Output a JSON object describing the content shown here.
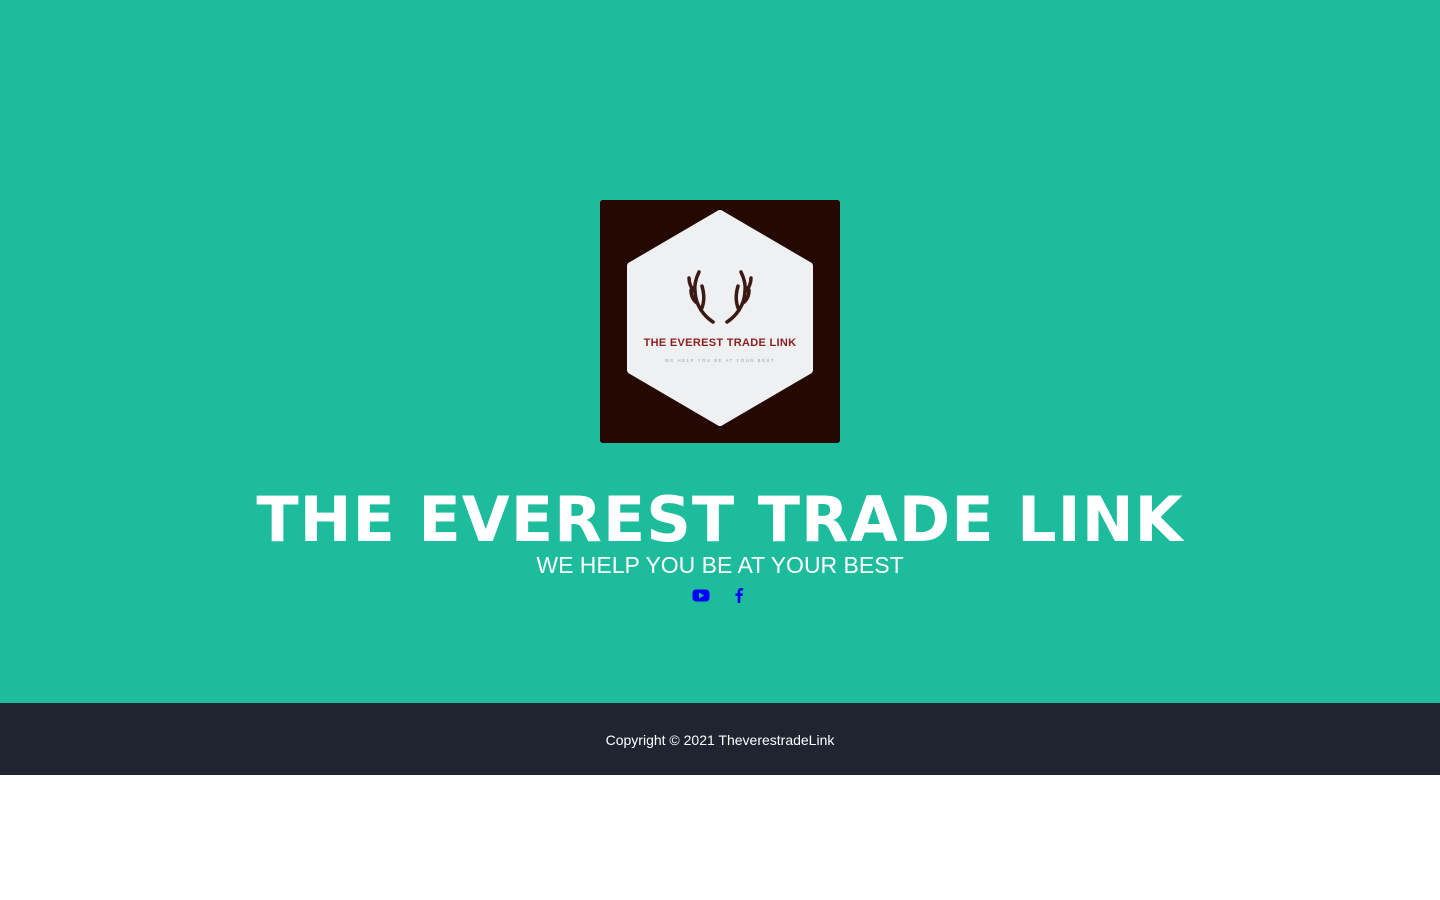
{
  "hero": {
    "background_color": "#1cbc9c",
    "logo": {
      "background_color": "#260802",
      "badge_color": "#eef0f2",
      "brand_text": "THE EVEREST TRADE LINK",
      "brand_text_color": "#8b1f1f",
      "small_text": "WE HELP YOU BE AT YOUR BEST",
      "icon": "antlers-icon"
    },
    "title": "THE EVEREST TRADE LINK",
    "tagline": "WE HELP YOU BE AT YOUR BEST",
    "social_links": [
      {
        "name": "youtube",
        "icon": "youtube-icon",
        "color": "#0000ff"
      },
      {
        "name": "facebook",
        "icon": "facebook-icon",
        "color": "#0000ff"
      }
    ]
  },
  "footer": {
    "background_color": "#1e2530",
    "copyright": "Copyright © 2021 TheverestradeLink"
  }
}
